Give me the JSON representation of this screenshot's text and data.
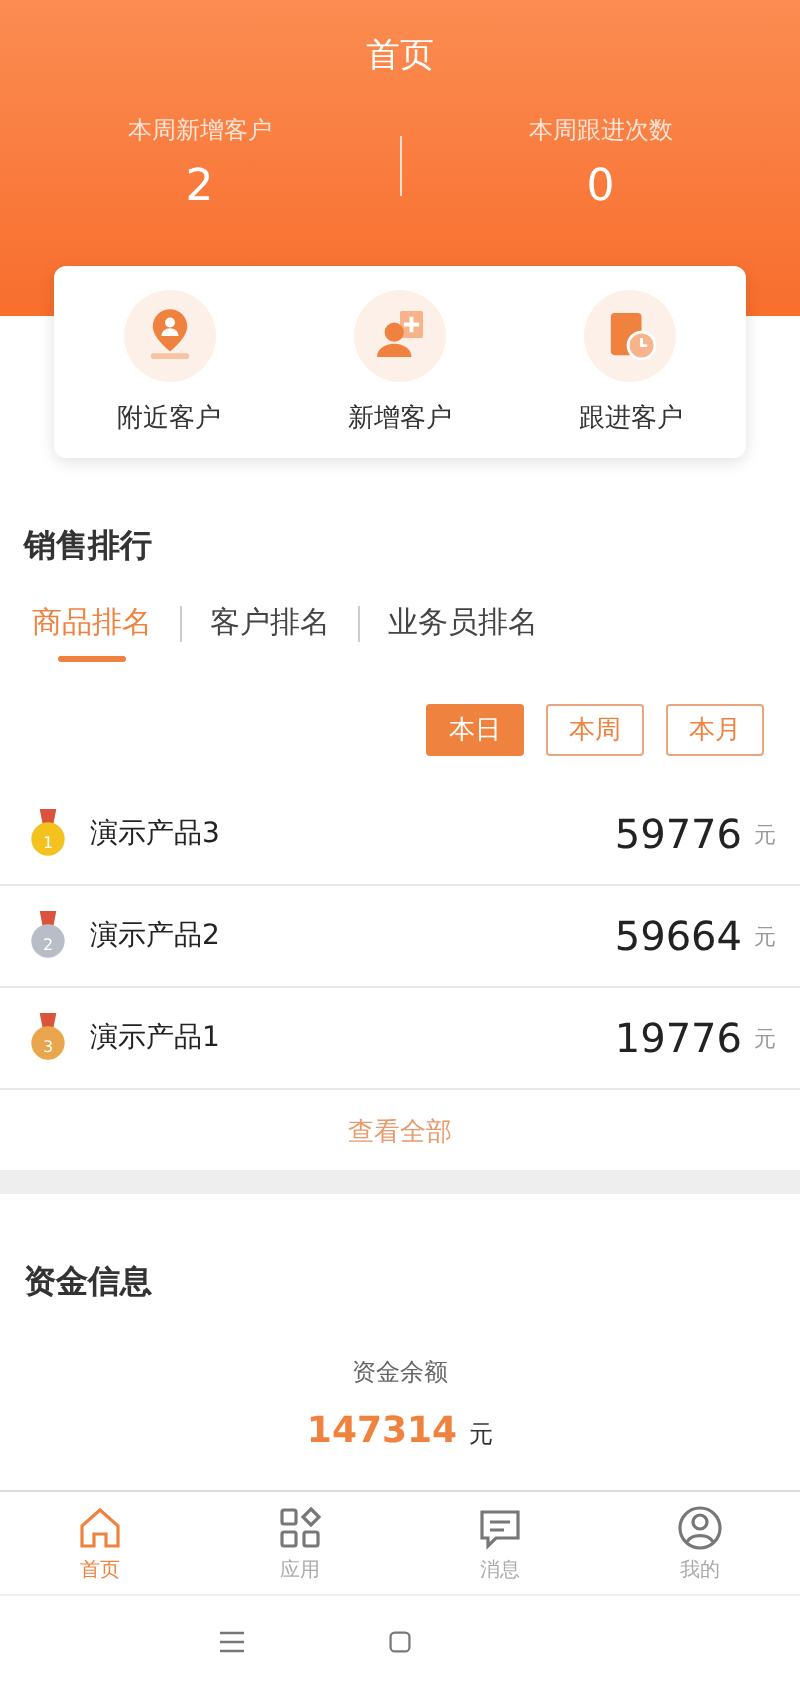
{
  "header": {
    "title": "首页",
    "stats": [
      {
        "label": "本周新增客户",
        "value": "2"
      },
      {
        "label": "本周跟进次数",
        "value": "0"
      }
    ]
  },
  "quick_actions": [
    {
      "label": "附近客户",
      "kind": "location"
    },
    {
      "label": "新增客户",
      "kind": "add"
    },
    {
      "label": "跟进客户",
      "kind": "followup"
    }
  ],
  "sales_ranking": {
    "title": "销售排行",
    "tabs": [
      {
        "label": "商品排名",
        "selected": true
      },
      {
        "label": "客户排名",
        "selected": false
      },
      {
        "label": "业务员排名",
        "selected": false
      }
    ],
    "periods": [
      {
        "label": "本日",
        "selected": true
      },
      {
        "label": "本周",
        "selected": false
      },
      {
        "label": "本月",
        "selected": false
      }
    ],
    "rows": [
      {
        "medal": "1",
        "color": "#f4c21f",
        "name": "演示产品3",
        "amount": "59776",
        "unit": "元"
      },
      {
        "medal": "2",
        "color": "#b9bdc7",
        "name": "演示产品2",
        "amount": "59664",
        "unit": "元"
      },
      {
        "medal": "3",
        "color": "#e9a64c",
        "name": "演示产品1",
        "amount": "19776",
        "unit": "元"
      }
    ],
    "view_all": "查看全部"
  },
  "funds": {
    "title": "资金信息",
    "balance_label": "资金余额",
    "balance": "147314",
    "balance_unit": "元"
  },
  "nav": [
    {
      "label": "首页",
      "kind": "home",
      "selected": true
    },
    {
      "label": "应用",
      "kind": "apps",
      "selected": false
    },
    {
      "label": "消息",
      "kind": "message",
      "selected": false
    },
    {
      "label": "我的",
      "kind": "profile",
      "selected": false
    }
  ]
}
